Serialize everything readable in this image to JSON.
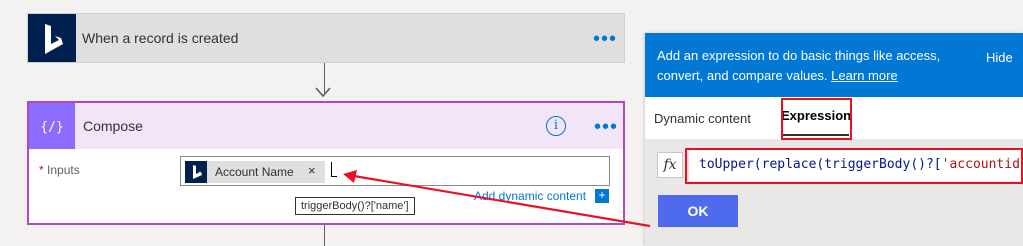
{
  "trigger": {
    "title": "When a record is created",
    "more_label": "•••",
    "icon": "dynamics-icon"
  },
  "compose": {
    "title": "Compose",
    "info_label": "i",
    "more_label": "•••",
    "icon": "compose-icon",
    "inputs_required_mark": "*",
    "inputs_label": "Inputs",
    "token": {
      "label": "Account Name",
      "close": "×"
    },
    "add_dynamic_content": "Add dynamic content",
    "add_dynamic_icon": "+"
  },
  "tooltip": "triggerBody()?['name']",
  "panel": {
    "description": "Add an expression to do basic things like access, convert, and compare values.",
    "learn_more": "Learn more",
    "hide": "Hide",
    "tabs": {
      "dynamic": "Dynamic content",
      "expression": "Expression"
    },
    "fx_label": "fx",
    "expression_func": "toUpper(replace(triggerBody()?[",
    "expression_str": "'accountid",
    "ok_label": "OK"
  },
  "colors": {
    "accent": "#0078d4",
    "compose": "#8c6cff",
    "highlight": "#e81123",
    "ok": "#4f6bed"
  }
}
